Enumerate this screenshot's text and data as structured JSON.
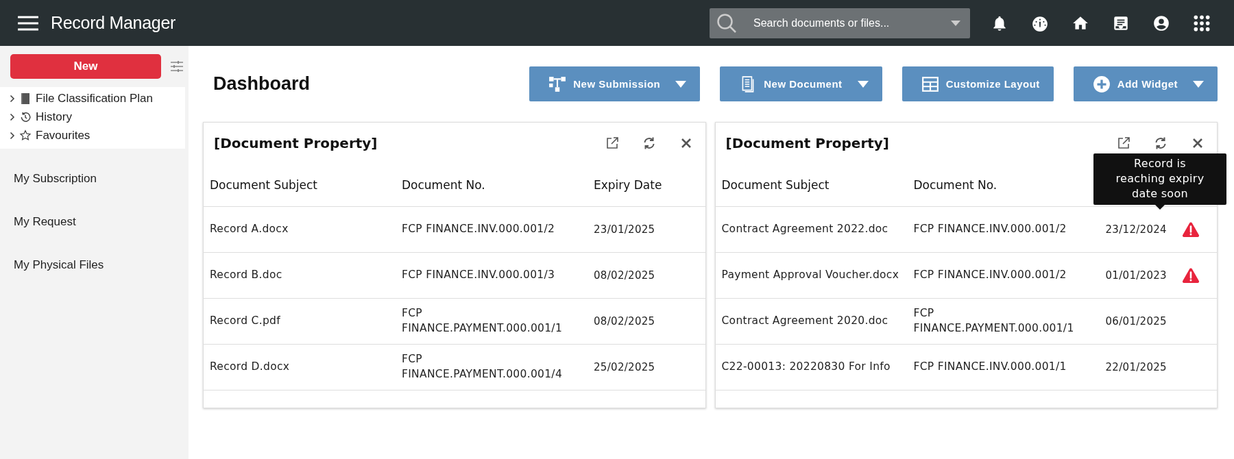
{
  "app_bar": {
    "title": "Record Manager",
    "search": {
      "placeholder": "Search documents or files..."
    }
  },
  "sidebar": {
    "new_button": "New",
    "tree": [
      {
        "label": "File Classification Plan",
        "expanded": false
      },
      {
        "label": "History",
        "expanded": false
      },
      {
        "label": "Favourites",
        "expanded": false
      }
    ],
    "items": [
      "My Subscription",
      "My Request",
      "My Physical Files"
    ]
  },
  "page": {
    "title": "Dashboard",
    "buttons": [
      {
        "label": "New Submission",
        "dropdown": true
      },
      {
        "label": "New Document",
        "dropdown": true
      },
      {
        "label": "Customize Layout",
        "dropdown": false
      },
      {
        "label": "Add Widget",
        "dropdown": true
      }
    ]
  },
  "panels": [
    {
      "title": "[Document Property]",
      "columns": [
        "Document Subject",
        "Document No.",
        "Expiry Date"
      ],
      "rows": [
        {
          "subject": "Record A.docx",
          "number": "FCP FINANCE.INV.000.001/2",
          "expiry": "23/01/2025",
          "warning": false
        },
        {
          "subject": "Record B.doc",
          "number": "FCP FINANCE.INV.000.001/3",
          "expiry": "08/02/2025",
          "warning": false
        },
        {
          "subject": "Record C.pdf",
          "number": "FCP FINANCE.PAYMENT.000.001/1",
          "expiry": "08/02/2025",
          "warning": false
        },
        {
          "subject": "Record D.docx",
          "number": "FCP FINANCE.PAYMENT.000.001/4",
          "expiry": "25/02/2025",
          "warning": false
        }
      ]
    },
    {
      "title": "[Document Property]",
      "columns": [
        "Document Subject",
        "Document No."
      ],
      "tooltip": "Record is reaching expiry date soon",
      "rows": [
        {
          "subject": "Contract Agreement 2022.doc",
          "number": "FCP FINANCE.INV.000.001/2",
          "expiry": "23/12/2024",
          "warning": true
        },
        {
          "subject": "Payment Approval Voucher.docx",
          "number": "FCP FINANCE.INV.000.001/2",
          "expiry": "01/01/2023",
          "warning": true
        },
        {
          "subject": "Contract Agreement 2020.doc",
          "number": "FCP FINANCE.PAYMENT.000.001/1",
          "expiry": "06/01/2025",
          "warning": false
        },
        {
          "subject": "C22-00013: 20220830 For Info",
          "number": "FCP FINANCE.INV.000.001/1",
          "expiry": "22/01/2025",
          "warning": false
        }
      ]
    }
  ]
}
